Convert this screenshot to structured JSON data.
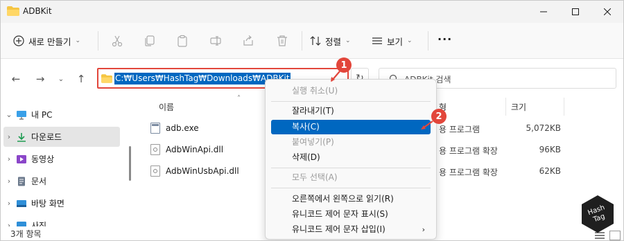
{
  "window": {
    "title": "ADBKit"
  },
  "toolbar": {
    "new_label": "새로 만들기",
    "sort_label": "정렬",
    "view_label": "보기",
    "more_label": "···"
  },
  "address": {
    "path": "C:₩Users₩HashTag₩Downloads₩ADBKit"
  },
  "search": {
    "placeholder": "ADBKit 검색"
  },
  "badges": [
    "1",
    "2"
  ],
  "sidebar": {
    "items": [
      {
        "label": "내 PC"
      },
      {
        "label": "다운로드"
      },
      {
        "label": "동영상"
      },
      {
        "label": "문서"
      },
      {
        "label": "바탕 화면"
      },
      {
        "label": "사진"
      }
    ]
  },
  "filelist": {
    "columns": {
      "name": "이름",
      "type_header": "형",
      "size": "크기"
    },
    "files": [
      {
        "name": "adb.exe",
        "type": "용 프로그램",
        "size": "5,072KB"
      },
      {
        "name": "AdbWinApi.dll",
        "type": "용 프로그램 확장",
        "size": "96KB"
      },
      {
        "name": "AdbWinUsbApi.dll",
        "type": "용 프로그램 확장",
        "size": "62KB"
      }
    ]
  },
  "status": {
    "text": "3개 항목"
  },
  "context_menu": {
    "items": [
      {
        "label": "실행 취소(U)"
      },
      {
        "label": "잘라내기(T)"
      },
      {
        "label": "복사(C)"
      },
      {
        "label": "붙여넣기(P)"
      },
      {
        "label": "삭제(D)"
      },
      {
        "label": "모두 선택(A)"
      },
      {
        "label": "오른쪽에서 왼쪽으로 읽기(R)"
      },
      {
        "label": "유니코드 제어 문자 표시(S)"
      },
      {
        "label": "유니코드 제어 문자 삽입(I)"
      }
    ]
  },
  "logo": {
    "text": "HashTag"
  },
  "colors": {
    "accent": "#0067c0",
    "highlight_box": "#e2463b",
    "folder": "#f5c542"
  }
}
